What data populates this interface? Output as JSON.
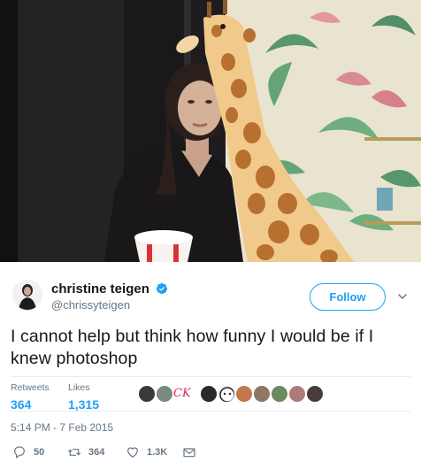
{
  "tweet": {
    "author": {
      "display_name": "christine teigen",
      "handle": "@chrissyteigen",
      "verified": true,
      "avatar_icon": "person-avatar"
    },
    "follow_label": "Follow",
    "text": "I cannot help but think how funny I would be if I knew photoshop",
    "stats": {
      "retweets_label": "Retweets",
      "retweets_value": "364",
      "likes_label": "Likes",
      "likes_value": "1,315"
    },
    "timestamp": "5:14 PM - 7 Feb 2015",
    "actions": {
      "reply_count": "50",
      "retweet_count": "364",
      "like_count": "1.3K"
    }
  },
  "colors": {
    "accent": "#1da1f2",
    "text_primary": "#14171a",
    "text_secondary": "#657786",
    "divider": "#e6ecf0",
    "ck_badge": "#e0245e"
  },
  "likers_avatar_text": [
    "CK"
  ]
}
